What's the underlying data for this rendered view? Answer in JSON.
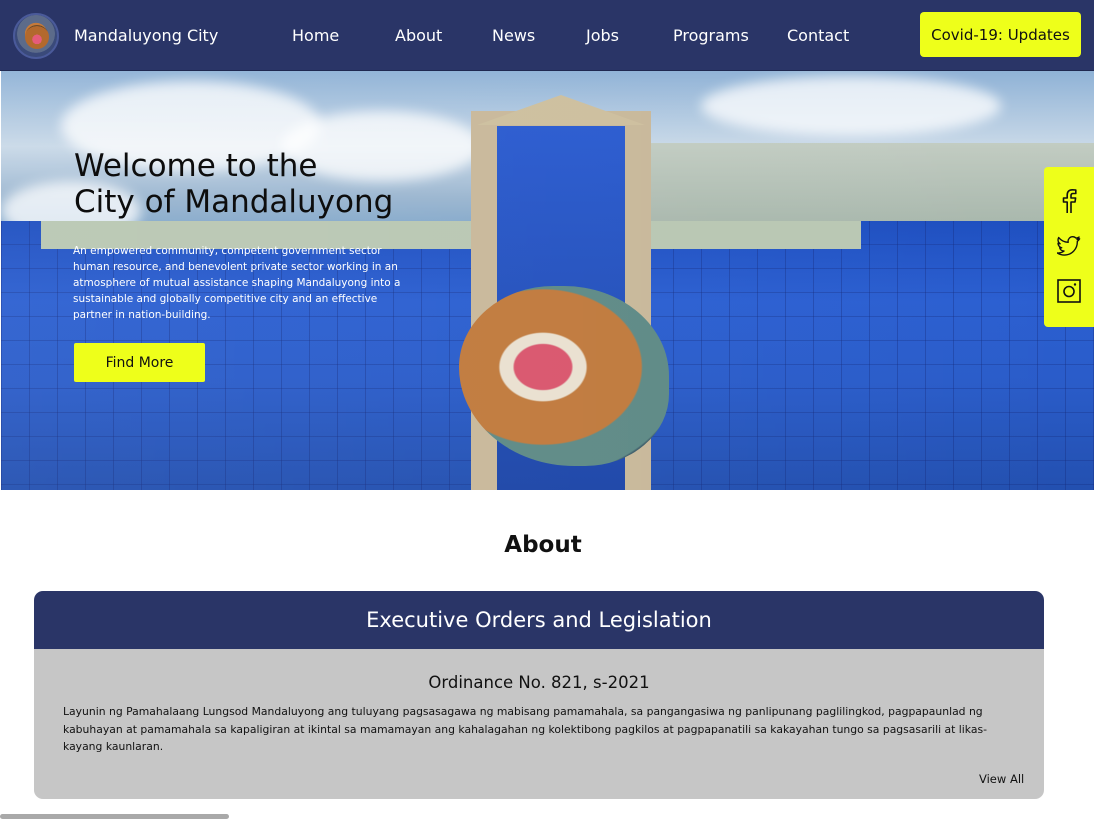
{
  "header": {
    "site_name": "Mandaluyong City",
    "nav": [
      "Home",
      "About",
      "News",
      "Jobs",
      "Programs",
      "Contact"
    ],
    "covid_button": "Covid-19: Updates"
  },
  "hero": {
    "title_line1": "Welcome to the",
    "title_line2": "City of Mandaluyong",
    "description": "An empowered community, competent government sector human resource, and benevolent private sector working in an atmosphere of mutual assistance shaping Mandaluyong into a sustainable and globally competitive city and an effective partner in nation-building.",
    "cta": "Find More"
  },
  "social": {
    "icons": [
      "facebook-icon",
      "twitter-icon",
      "instagram-icon"
    ]
  },
  "about": {
    "section_title": "About",
    "card_title": "Executive Orders and Legislation",
    "ordinance_title": "Ordinance No. 821, s-2021",
    "ordinance_text": "Layunin ng Pamahalaang Lungsod Mandaluyong ang tuluyang pagsasagawa ng mabisang pamamahala, sa pangangasiwa ng panlipunang paglilingkod, pagpapaunlad ng kabuhayan at pamamahala sa kapaligiran at ikintal sa mamamayan ang kahalagahan ng kolektibong pagkilos at pagpapanatili sa kakayahan tungo sa pagsasarili at likas-kayang kaunlaran.",
    "view_all": "View All"
  },
  "colors": {
    "navy": "#2a3567",
    "accent_yellow": "#eeff1a",
    "card_gray": "#c6c6c6"
  }
}
